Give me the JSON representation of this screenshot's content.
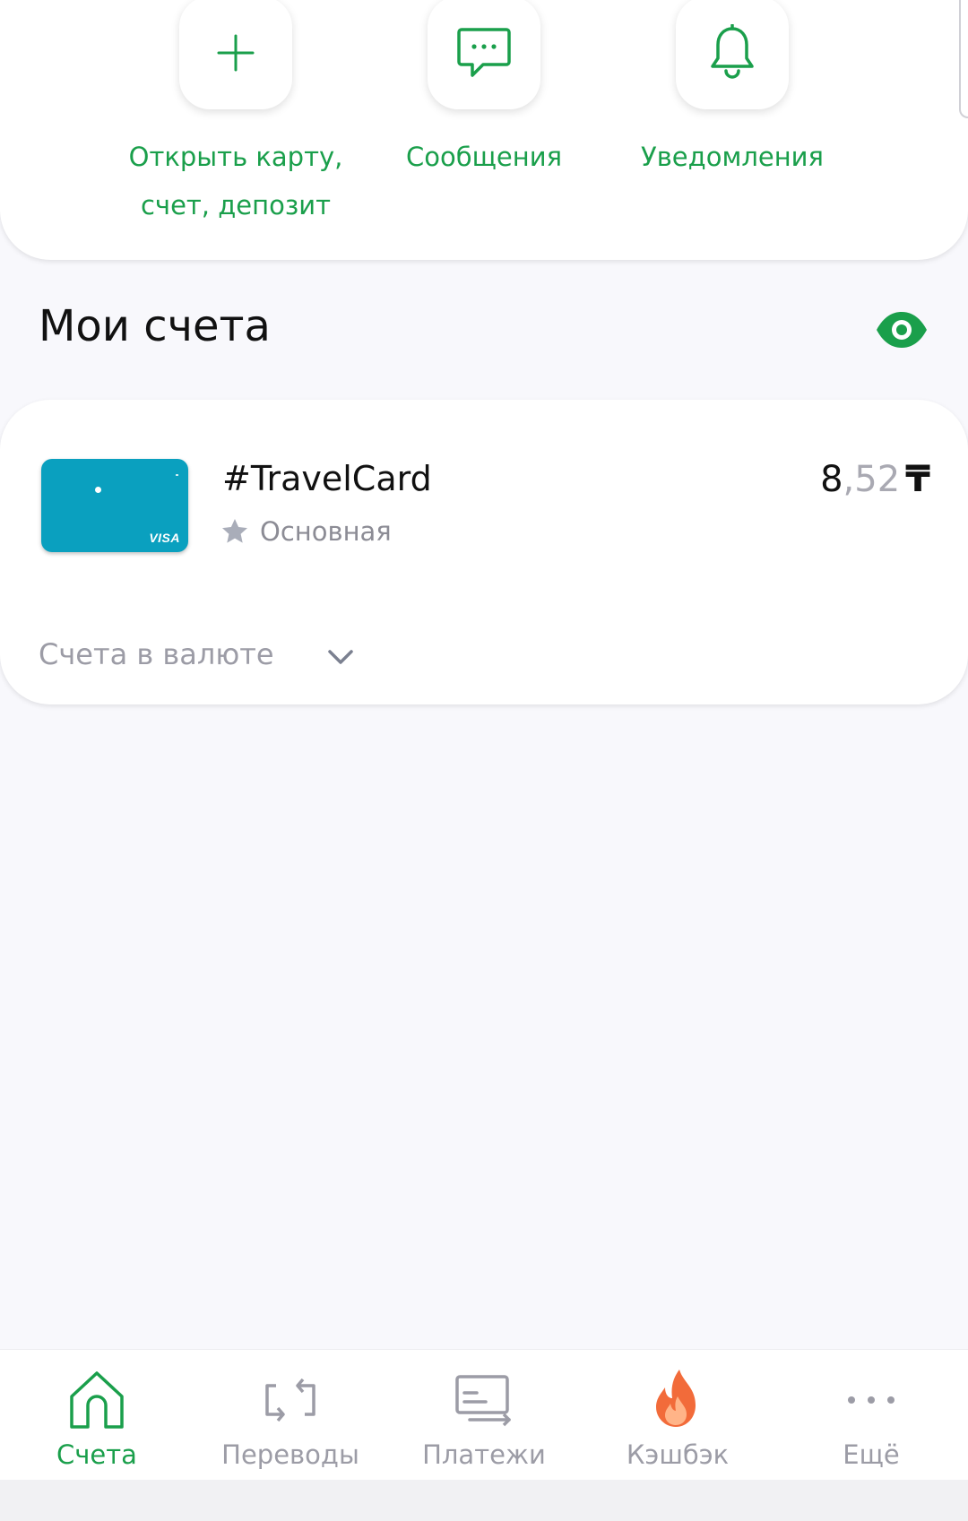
{
  "quick_actions": [
    {
      "label": "Открыть карту, счет, депозит",
      "icon": "plus-icon"
    },
    {
      "label": "Сообщения",
      "icon": "chat-bubble-icon"
    },
    {
      "label": "Уведомления",
      "icon": "bell-icon"
    }
  ],
  "section": {
    "title": "Мои счета",
    "visibility_icon": "eye-icon"
  },
  "account": {
    "name": "#TravelCard",
    "subtitle": "Основная",
    "card_brand": "VISA",
    "balance_int": "8",
    "balance_dec": ",52",
    "currency": "₸"
  },
  "currency_accounts": {
    "label": "Счета в валюте"
  },
  "nav": [
    {
      "label": "Счета",
      "icon": "home-icon",
      "active": true
    },
    {
      "label": "Переводы",
      "icon": "transfer-icon",
      "active": false
    },
    {
      "label": "Платежи",
      "icon": "payment-icon",
      "active": false
    },
    {
      "label": "Кэшбэк",
      "icon": "flame-icon",
      "active": false
    },
    {
      "label": "Ещё",
      "icon": "more-icon",
      "active": false
    }
  ],
  "colors": {
    "accent": "#1a9f4b",
    "card": "#0aa0bf",
    "muted": "#9c9ca6",
    "background": "#f8f8fc",
    "flame": "#f26b3a"
  }
}
